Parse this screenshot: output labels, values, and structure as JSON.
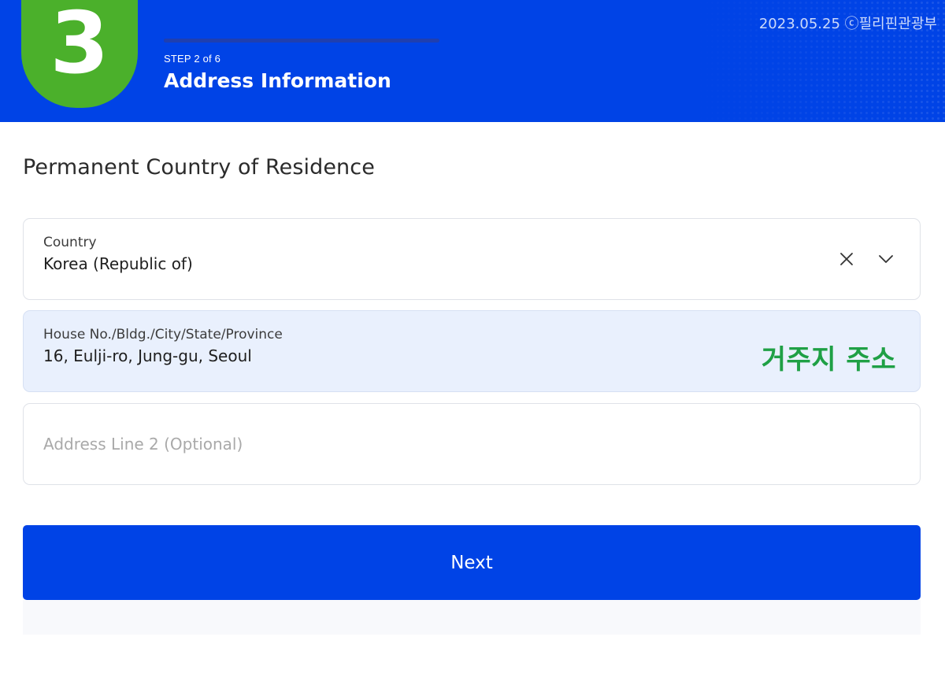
{
  "header": {
    "step_number": "3",
    "step_label": "STEP 2 of 6",
    "title": "Address Information",
    "watermark": "2023.05.25 ⓒ필리핀관광부",
    "progress_fraction": 0.333,
    "colors": {
      "header_bg": "#0043e6",
      "badge_bg": "#4bb02b"
    }
  },
  "section": {
    "title": "Permanent Country of Residence"
  },
  "fields": {
    "country": {
      "label": "Country",
      "value": "Korea (Republic of)",
      "clear_icon": "close-icon",
      "dropdown_icon": "chevron-down-icon"
    },
    "address_line_1": {
      "label": "House No./Bldg./City/State/Province",
      "value": "16, Eulji-ro, Jung-gu, Seoul",
      "annotation": "거주지 주소"
    },
    "address_line_2": {
      "value": "",
      "placeholder": "Address Line 2 (Optional)"
    }
  },
  "actions": {
    "next_label": "Next"
  }
}
